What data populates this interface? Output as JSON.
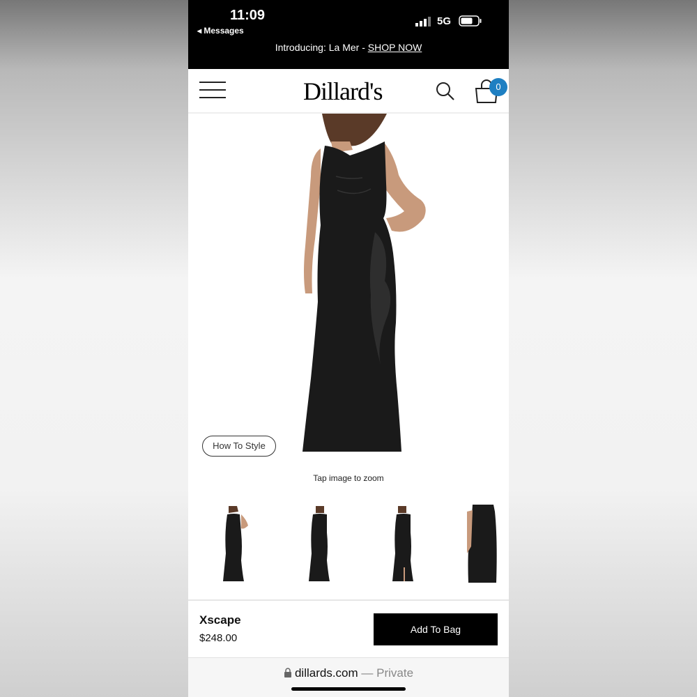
{
  "status_bar": {
    "time": "11:09",
    "back_label": "◂ Messages",
    "network": "5G"
  },
  "promo": {
    "text": "Introducing: La Mer - ",
    "link": "SHOP NOW"
  },
  "header": {
    "logo": "Dillard's",
    "bag_count": "0"
  },
  "product": {
    "how_to_style": "How To Style",
    "zoom_hint": "Tap image to zoom",
    "brand": "Xscape",
    "price": "$248.00",
    "add_to_bag": "Add To Bag"
  },
  "browser": {
    "domain": "dillards.com",
    "mode": " — Private"
  },
  "colors": {
    "accent_badge": "#1e7fc2",
    "dress": "#1a1a1a"
  }
}
